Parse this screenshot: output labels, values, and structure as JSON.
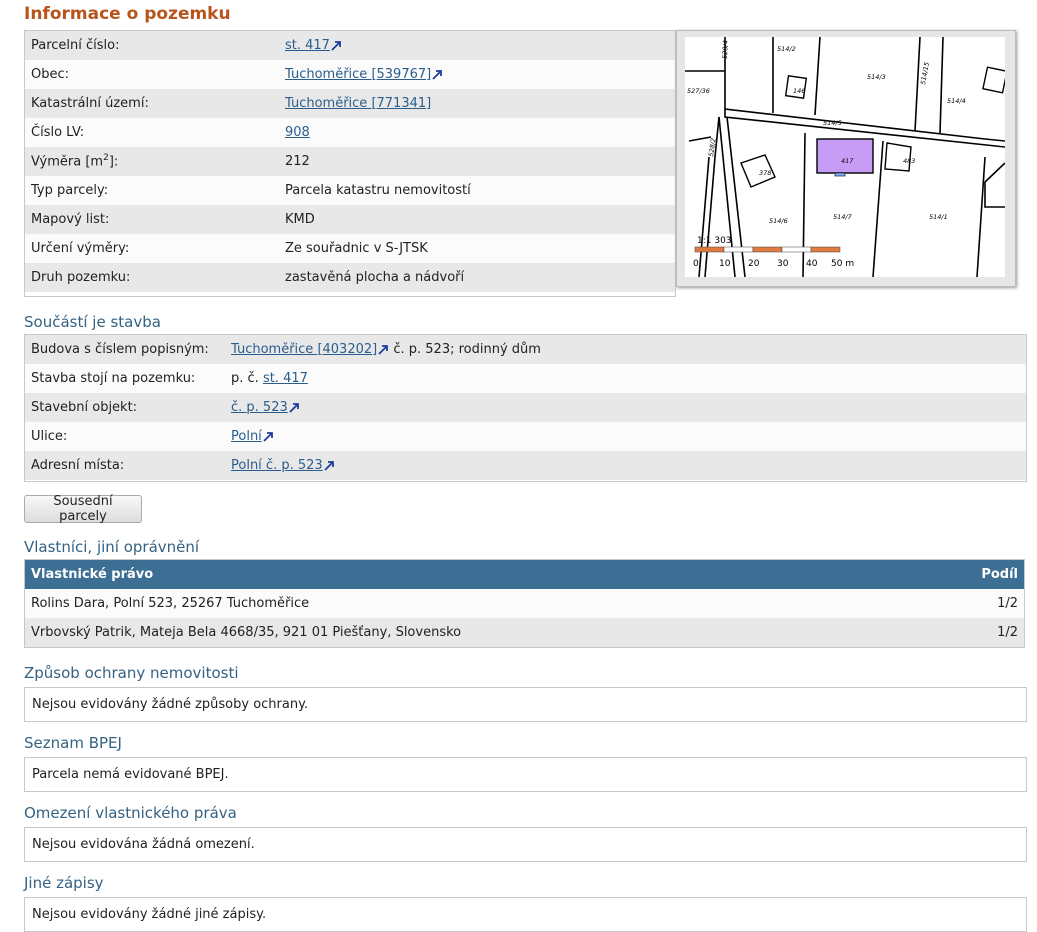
{
  "title": "Informace o pozemku",
  "parcel": {
    "rows": [
      {
        "label": "Parcelní číslo:",
        "value": "st. 417",
        "link": true,
        "ext": true
      },
      {
        "label": "Obec:",
        "value": "Tuchoměřice [539767]",
        "link": true,
        "ext": true
      },
      {
        "label": "Katastrální území:",
        "value": "Tuchoměřice [771341]",
        "link": true,
        "ext": false
      },
      {
        "label": "Číslo LV:",
        "value": "908",
        "link": true,
        "ext": false
      },
      {
        "label": "Výměra [m2]:",
        "value": "212",
        "link": false,
        "ext": false
      },
      {
        "label": "Typ parcely:",
        "value": "Parcela katastru nemovitostí",
        "link": false,
        "ext": false
      },
      {
        "label": "Mapový list:",
        "value": "KMD",
        "link": false,
        "ext": false
      },
      {
        "label": "Určení výměry:",
        "value": "Ze souřadnic v S-JTSK",
        "link": false,
        "ext": false
      },
      {
        "label": "Druh pozemku:",
        "value": "zastavěná plocha a nádvoří",
        "link": false,
        "ext": false
      }
    ]
  },
  "map": {
    "scale_text": "1:1 303",
    "scale_ticks": [
      "0",
      "10",
      "20",
      "30",
      "40",
      "50 m"
    ],
    "parcel_labels": [
      "514/2",
      "514/3",
      "514/15",
      "514/4",
      "146",
      "527/36",
      "514/5",
      "514/1",
      "528/2",
      "378",
      "417",
      "483",
      "514/6",
      "514/7",
      "528/4"
    ],
    "highlight_color": "#c79cf5"
  },
  "building": {
    "heading": "Součástí je stavba",
    "rows": [
      {
        "label": "Budova s číslem popisným:",
        "link": "Tuchoměřice [403202]",
        "suffix": " č. p. 523; rodinný dům"
      },
      {
        "label": "Stavba stojí na pozemku:",
        "prefix": "p. č. ",
        "link": "st. 417"
      },
      {
        "label": "Stavební objekt:",
        "link": "č. p. 523"
      },
      {
        "label": "Ulice:",
        "link": "Polní"
      },
      {
        "label": "Adresní místa:",
        "link": "Polní č. p. 523"
      }
    ]
  },
  "neighbors_button": "Sousední parcely",
  "owners": {
    "heading": "Vlastníci, jiní oprávnění",
    "col_right": "Vlastnické právo",
    "col_share": "Podíl",
    "rows": [
      {
        "name": "Rolins Dara, Polní 523, 25267 Tuchoměřice",
        "share": "1/2"
      },
      {
        "name": "Vrbovský Patrik, Mateja Bela 4668/35, 921 01 Piešťany, Slovensko",
        "share": "1/2"
      }
    ]
  },
  "protection": {
    "heading": "Způsob ochrany nemovitosti",
    "text": "Nejsou evidovány žádné způsoby ochrany."
  },
  "bpej": {
    "heading": "Seznam BPEJ",
    "text": "Parcela nemá evidované BPEJ."
  },
  "restrictions": {
    "heading": "Omezení vlastnického práva",
    "text": "Nejsou evidována žádná omezení."
  },
  "other": {
    "heading": "Jiné zápisy",
    "text": "Nejsou evidovány žádné jiné zápisy."
  },
  "colors": {
    "heading_main": "#b7541c",
    "heading_section": "#356283",
    "link": "#2b5d8c",
    "table_header": "#3d6f95"
  }
}
